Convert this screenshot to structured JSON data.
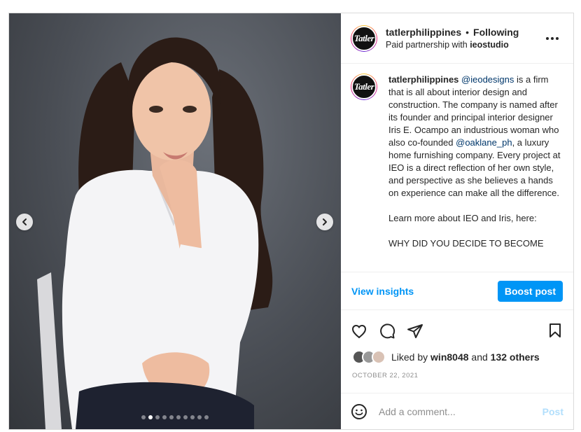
{
  "header": {
    "username": "tatlerphilippines",
    "separator": "•",
    "follow_status": "Following",
    "partnership_prefix": "Paid partnership with ",
    "partner": "ieostudio",
    "avatar_text": "Tatler",
    "more_icon": "more-horizontal-icon"
  },
  "media": {
    "prev_icon": "chevron-left-icon",
    "next_icon": "chevron-right-icon",
    "slide_count": 10,
    "active_slide": 2
  },
  "caption": {
    "username": "tatlerphilippines",
    "mention1": "@ieodesigns",
    "text1": " is a firm that is all about interior design and construction. The company is named after its founder and principal interior designer Iris E. Ocampo an industrious woman who also co-founded ",
    "mention2": "@oaklane_ph",
    "text2": ", a luxury home furnishing company. Every project at IEO is a direct reflection of her own style, and perspective as she believes a hands on experience can make all the difference.\n\nLearn more about IEO and Iris, here:\n\nWHY DID YOU DECIDE TO BECOME"
  },
  "insights": {
    "view_label": "View insights",
    "boost_label": "Boost post"
  },
  "actions": {
    "like_icon": "heart-icon",
    "comment_icon": "comment-icon",
    "share_icon": "share-icon",
    "save_icon": "bookmark-icon"
  },
  "likes": {
    "prefix": "Liked by ",
    "user": "win8048",
    "middle": " and ",
    "others": "132 others"
  },
  "date": "OCTOBER 22, 2021",
  "comment": {
    "emoji_icon": "emoji-icon",
    "placeholder": "Add a comment...",
    "post_label": "Post"
  },
  "colors": {
    "accent": "#0095f6",
    "post_disabled": "#b2dffc",
    "mention": "#00376b"
  }
}
